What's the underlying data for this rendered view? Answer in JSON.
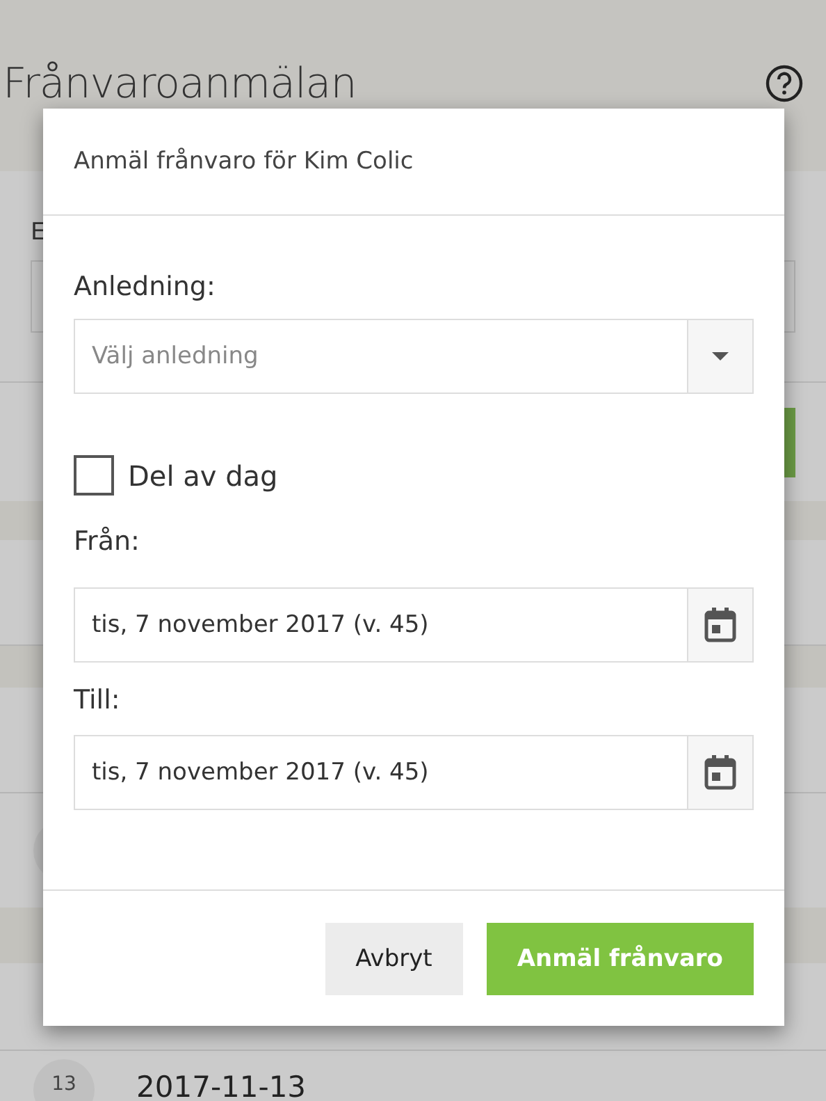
{
  "background": {
    "title": "Frånvaroanmälan",
    "section_label": "E",
    "entry": {
      "day": "13",
      "date": "2017-11-13"
    }
  },
  "dialog": {
    "title": "Anmäl frånvaro för Kim Colic",
    "reason": {
      "label": "Anledning:",
      "placeholder": "Välj anledning"
    },
    "part_of_day": {
      "label": "Del av dag",
      "checked": false
    },
    "from": {
      "label": "Från:",
      "value": "tis, 7 november 2017 (v. 45)"
    },
    "to": {
      "label": "Till:",
      "value": "tis, 7 november 2017 (v. 45)"
    },
    "buttons": [
      {
        "label": "Avbryt",
        "kind": "secondary"
      },
      {
        "label": "Anmäl frånvaro",
        "kind": "primary"
      }
    ]
  }
}
